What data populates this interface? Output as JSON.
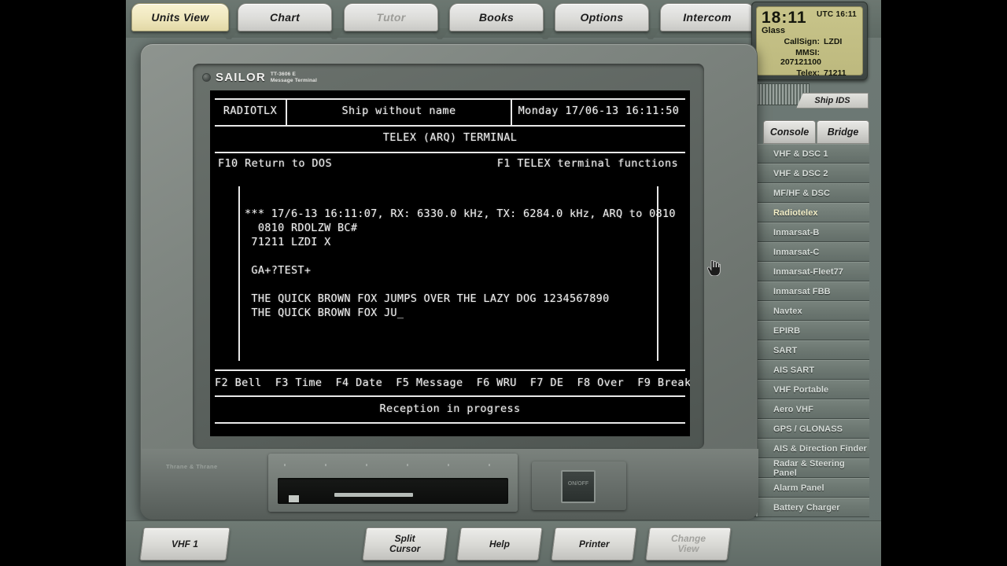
{
  "topbar": {
    "tabs": [
      {
        "label": "Units View",
        "state": "active"
      },
      {
        "label": "Chart",
        "state": "normal"
      },
      {
        "label": "Tutor",
        "state": "disabled"
      },
      {
        "label": "Books",
        "state": "normal"
      },
      {
        "label": "Options",
        "state": "normal"
      },
      {
        "label": "Intercom",
        "state": "normal"
      }
    ]
  },
  "clock": {
    "local_time": "18:11",
    "utc_label": "UTC 16:11",
    "ship_name": "Glass",
    "fields": [
      {
        "key": "CallSign:",
        "value": "LZDI"
      },
      {
        "key": "MMSI:",
        "value": "207121100"
      },
      {
        "key": "Telex:",
        "value": "71211"
      }
    ]
  },
  "ship_ids_button": "Ship IDS",
  "view_tabs": [
    {
      "label": "Console",
      "state": "active"
    },
    {
      "label": "Bridge",
      "state": "normal"
    }
  ],
  "sidebar": {
    "items": [
      {
        "label": "VHF & DSC 1",
        "selected": false
      },
      {
        "label": "VHF & DSC 2",
        "selected": false
      },
      {
        "label": "MF/HF & DSC",
        "selected": false
      },
      {
        "label": "Radiotelex",
        "selected": true
      },
      {
        "label": "Inmarsat-B",
        "selected": false
      },
      {
        "label": "Inmarsat-C",
        "selected": false
      },
      {
        "label": "Inmarsat-Fleet77",
        "selected": false
      },
      {
        "label": "Inmarsat FBB",
        "selected": false
      },
      {
        "label": "Navtex",
        "selected": false
      },
      {
        "label": "EPIRB",
        "selected": false
      },
      {
        "label": "SART",
        "selected": false
      },
      {
        "label": "AIS SART",
        "selected": false
      },
      {
        "label": "VHF Portable",
        "selected": false
      },
      {
        "label": "Aero VHF",
        "selected": false
      },
      {
        "label": "GPS / GLONASS",
        "selected": false
      },
      {
        "label": "AIS & Direction Finder",
        "selected": false
      },
      {
        "label": "Radar & Steering Panel",
        "selected": false
      },
      {
        "label": "Alarm Panel",
        "selected": false
      },
      {
        "label": "Battery Charger",
        "selected": false
      }
    ]
  },
  "device": {
    "brand": "SAILOR",
    "model_line1": "TT-3606 E",
    "model_line2": "Message Terminal",
    "manufacturer": "Thrane & Thrane",
    "power_glyph": "ON/OFF"
  },
  "terminal": {
    "header_left": "RADIOTLX",
    "header_center": "Ship without name",
    "header_right": "Monday 17/06-13 16:11:50",
    "title": "TELEX (ARQ) TERMINAL",
    "hint_left": "F10 Return to DOS",
    "hint_right": "F1 TELEX terminal functions",
    "body_lines": [
      "*** 17/6-13 16:11:07, RX: 6330.0 kHz, TX: 6284.0 kHz, ARQ to 0810",
      "  0810 RDOLZW BC#",
      " 71211 LZDI X",
      "",
      " GA+?TEST+",
      "",
      " THE QUICK BROWN FOX JUMPS OVER THE LAZY DOG 1234567890",
      " THE QUICK BROWN FOX JU_"
    ],
    "fkeys": "F2 Bell  F3 Time  F4 Date  F5 Message  F6 WRU  F7 DE  F8 Over  F9 Break",
    "status": "Reception in progress"
  },
  "bottombar": {
    "buttons": [
      {
        "label": "VHF 1",
        "state": "normal",
        "two_line": false
      },
      {
        "label": "Split\nCursor",
        "state": "normal",
        "two_line": true
      },
      {
        "label": "Help",
        "state": "normal",
        "two_line": false
      },
      {
        "label": "Printer",
        "state": "normal",
        "two_line": false
      },
      {
        "label": "Change\nView",
        "state": "disabled",
        "two_line": true
      }
    ]
  },
  "colors": {
    "panel_bg": "#6b7672",
    "clock_bg": "#c8c48a",
    "active_tab": "#f0e8bd",
    "crt_bg": "#000000",
    "crt_fg": "#f0f0f0",
    "selected_sidebar_text": "#f3efc8"
  }
}
